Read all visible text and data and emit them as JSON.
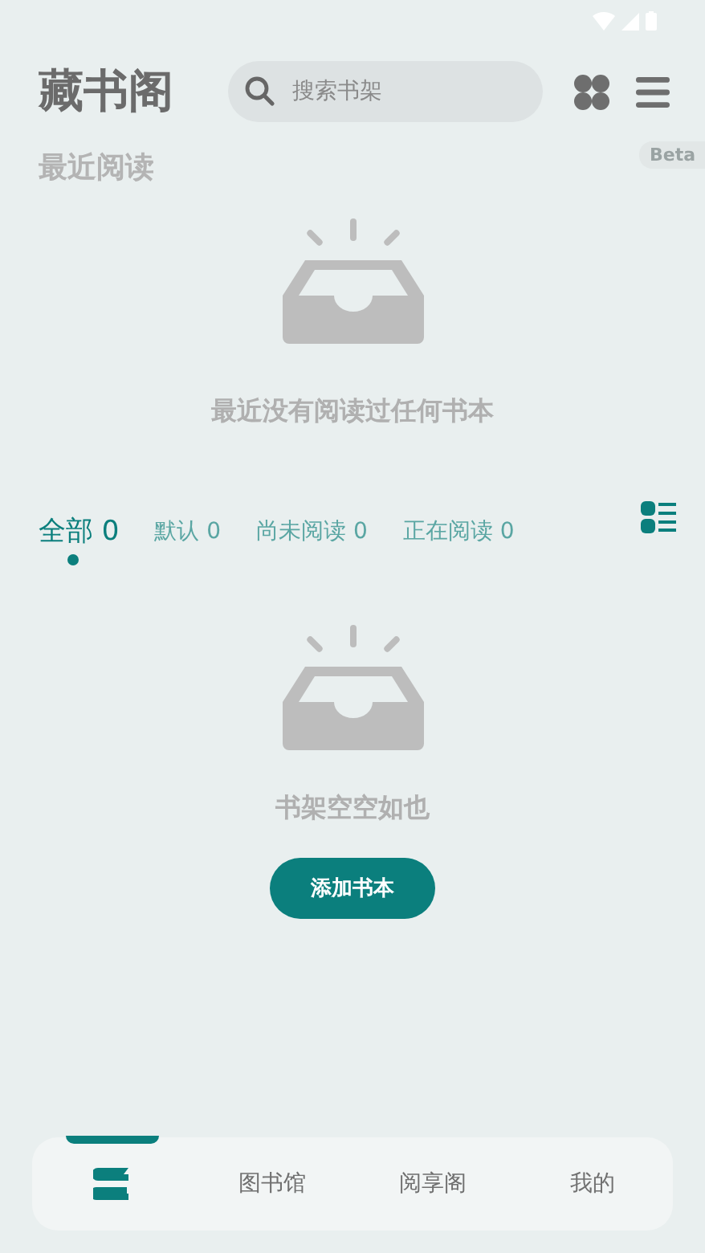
{
  "header": {
    "title": "藏书阁",
    "search": {
      "placeholder": "搜索书架"
    }
  },
  "recent": {
    "title": "最近阅读",
    "badge": "Beta",
    "empty_text": "最近没有阅读过任何书本"
  },
  "shelf_tabs": [
    {
      "label": "全部 0",
      "selected": true
    },
    {
      "label": "默认 0",
      "selected": false
    },
    {
      "label": "尚未阅读 0",
      "selected": false
    },
    {
      "label": "正在阅读 0",
      "selected": false
    }
  ],
  "shelf": {
    "empty_text": "书架空空如也",
    "add_button": "添加书本"
  },
  "bottom_nav": [
    {
      "kind": "icon",
      "selected": true
    },
    {
      "kind": "text",
      "label": "图书馆",
      "selected": false
    },
    {
      "kind": "text",
      "label": "阅享阁",
      "selected": false
    },
    {
      "kind": "text",
      "label": "我的",
      "selected": false
    }
  ]
}
